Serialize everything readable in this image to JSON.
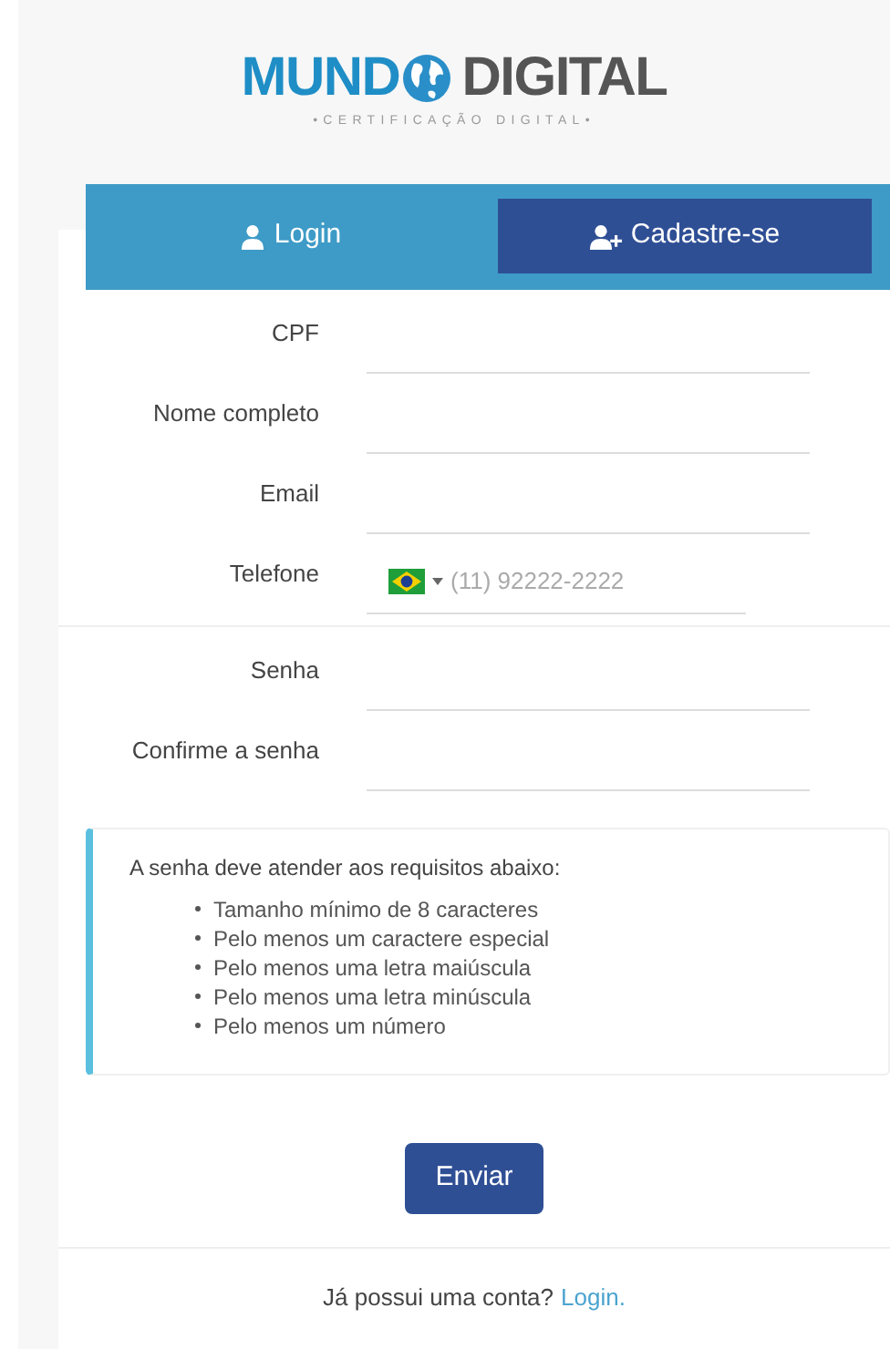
{
  "logo": {
    "word_left": "MUND",
    "word_right": "DIGITAL",
    "tagline": "•CERTIFICAÇÃO DIGITAL•"
  },
  "tabs": [
    {
      "label": "Login",
      "kind": "user",
      "selected": false
    },
    {
      "label": "Cadastre-se",
      "kind": "user-plus",
      "selected": true
    }
  ],
  "sections": [
    {
      "fields": [
        {
          "kind": "text",
          "label": "CPF"
        },
        {
          "kind": "text",
          "label": "Nome completo"
        },
        {
          "kind": "text",
          "label": "Email"
        },
        {
          "kind": "phone",
          "label": "Telefone",
          "placeholder": "(11) 92222-2222"
        }
      ]
    },
    {
      "fields": [
        {
          "kind": "password",
          "label": "Senha"
        },
        {
          "kind": "password",
          "label": "Confirme a senha"
        }
      ]
    }
  ],
  "requirements": {
    "title": "A senha deve atender aos requisitos abaixo:",
    "items": [
      "Tamanho mínimo de 8 caracteres",
      "Pelo menos um caractere especial",
      "Pelo menos uma letra maiúscula",
      "Pelo menos uma letra minúscula",
      "Pelo menos um número"
    ]
  },
  "submit_button": "Enviar",
  "footer": {
    "text": "Já possui uma conta?",
    "link": "Login."
  }
}
